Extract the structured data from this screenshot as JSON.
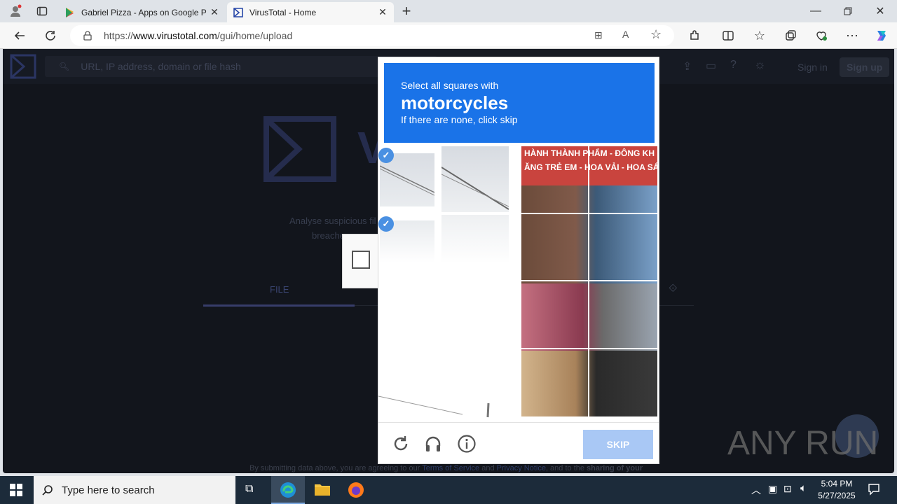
{
  "browser": {
    "tabs": [
      {
        "title": "Gabriel Pizza - Apps on Google P",
        "active": false
      },
      {
        "title": "VirusTotal - Home",
        "active": true
      }
    ],
    "url_prefix": "https://",
    "url_host": "www.virustotal.com",
    "url_path": "/gui/home/upload"
  },
  "vt": {
    "search_placeholder": "URL, IP address, domain or file hash",
    "sign_in": "Sign in",
    "sign_up": "Sign up",
    "tagline1": "Analyse suspicious fil",
    "tagline2": "breache",
    "file_tab": "FILE",
    "footer_a": "By submitting data above, you are agreeing to our",
    "terms": "Terms of Service",
    "and": "and",
    "privacy": "Privacy Notice",
    "footer_b": ", and to the",
    "footer_c": "sharing of your"
  },
  "captcha": {
    "line1": "Select all squares with",
    "object": "motorcycles",
    "line3": "If there are none, click skip",
    "skip": "SKIP"
  },
  "taskbar": {
    "search_placeholder": "Type here to search",
    "time": "5:04 PM",
    "date": "5/27/2025"
  },
  "watermark": "ANY RUN"
}
